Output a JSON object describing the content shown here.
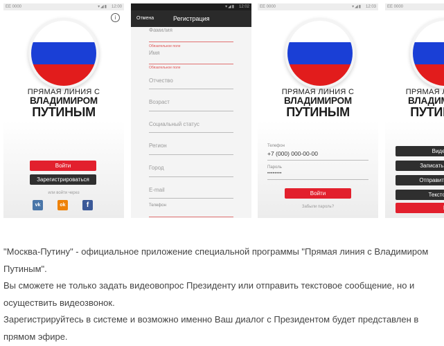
{
  "statusbar": {
    "carrier": "EE 0000",
    "signal": "▾◢▮",
    "times": [
      "12:00",
      "12:02",
      "12:03"
    ]
  },
  "app_title": {
    "line1": "ПРЯМАЯ ЛИНИЯ С",
    "line2": "ВЛАДИМИРОМ",
    "line3": "ПУТИНЫМ"
  },
  "screen1": {
    "login": "Войти",
    "register": "Зарегистрироваться",
    "login_via": "или войти через",
    "social": {
      "vk": "vk",
      "ok": "ok",
      "fb": "f"
    }
  },
  "screen2": {
    "cancel": "Отмена",
    "title": "Регистрация",
    "required": "Обязательное поле",
    "fields": {
      "surname": "Фамилия",
      "name": "Имя",
      "patronymic": "Отчество",
      "age": "Возраст",
      "social_status": "Социальный статус",
      "region": "Регион",
      "city": "Город",
      "email": "E-mail",
      "phone": "Телефон"
    }
  },
  "screen3": {
    "phone_label": "Телефон",
    "phone_value": "+7 (000) 000-00-00",
    "password_label": "Пароль",
    "password_value": "••••••••",
    "login": "Войти",
    "forgot": "Забыли пароль?"
  },
  "screen4": {
    "buttons": [
      "Видео",
      "Записать вид",
      "Отправить ви",
      "Текстовое",
      "Вы"
    ]
  },
  "description": {
    "p1": "\"Москва-Путину\" - официальное приложение специальной программы \"Прямая линия с Владимиром Путиным\".",
    "p2": "Вы сможете не только задать видеовопрос Президенту или отправить текстовое сообщение, но и осуществить видеозвонок.",
    "p3": "Зарегистрируйтесь в системе и возможно именно Ваш диалог с Президентом будет представлен в прямом эфире."
  },
  "colors": {
    "accent_red": "#e2202d",
    "dark_button": "#2f2f2f",
    "flag_blue": "#1a3fd6",
    "flag_red": "#e21c1c",
    "vk": "#4a76a8",
    "ok": "#ee8208",
    "fb": "#3b5998"
  }
}
